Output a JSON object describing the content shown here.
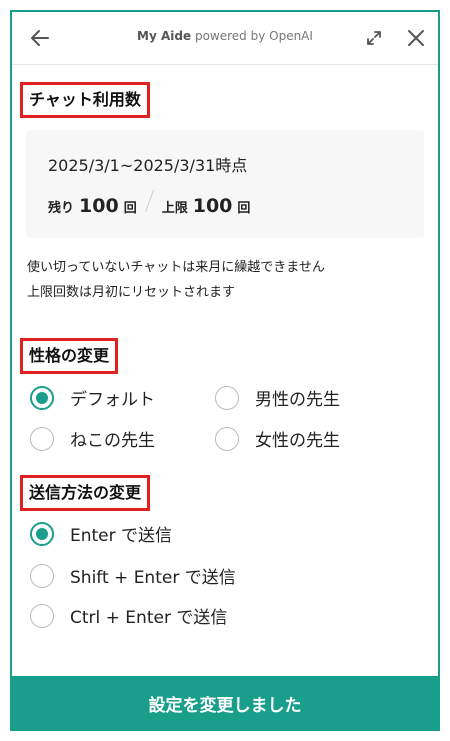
{
  "colors": {
    "accent": "#1a9e8c",
    "highlight_box": "#e32020"
  },
  "header": {
    "title": "My Aide",
    "subtitle": "powered by OpenAI",
    "back_icon": "arrow-left-icon",
    "expand_icon": "expand-icon",
    "close_icon": "close-icon"
  },
  "usage": {
    "section_title": "チャット利用数",
    "period": "2025/3/1~2025/3/31時点",
    "remaining_label": "残り",
    "remaining_value": "100",
    "remaining_unit": "回",
    "limit_label": "上限",
    "limit_value": "100",
    "limit_unit": "回",
    "note_line1": "使い切っていないチャットは来月に繰越できません",
    "note_line2": "上限回数は月初にリセットされます"
  },
  "personality": {
    "section_title": "性格の変更",
    "options": [
      {
        "label": "デフォルト",
        "selected": true
      },
      {
        "label": "男性の先生",
        "selected": false
      },
      {
        "label": "ねこの先生",
        "selected": false
      },
      {
        "label": "女性の先生",
        "selected": false
      }
    ]
  },
  "send_method": {
    "section_title": "送信方法の変更",
    "options": [
      {
        "label": "Enter で送信",
        "selected": true
      },
      {
        "label": "Shift + Enter で送信",
        "selected": false
      },
      {
        "label": "Ctrl + Enter で送信",
        "selected": false
      }
    ]
  },
  "footer": {
    "button_label": "設定を変更しました"
  }
}
